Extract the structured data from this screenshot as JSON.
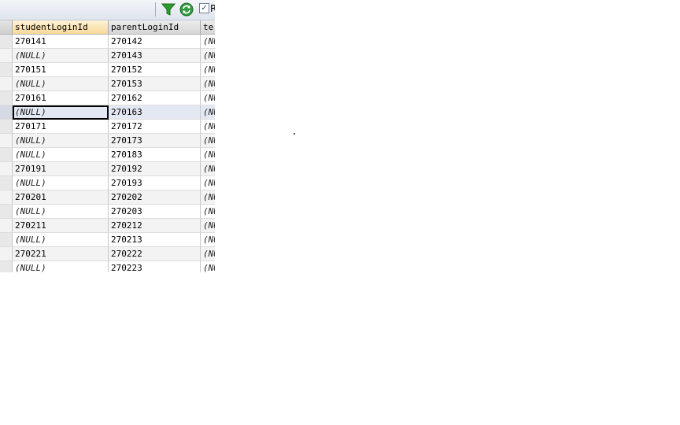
{
  "toolbar": {
    "filter_icon": "filter-funnel-icon",
    "refresh_icon": "refresh-icon",
    "checkbox_mark": "✓",
    "clipped_label": "R"
  },
  "grid": {
    "columns": [
      "studentLoginId",
      "parentLoginId",
      "te"
    ],
    "null_text": "(NULL)",
    "clipped_null": "(NU",
    "rows": [
      {
        "student": "270141",
        "parent": "270142",
        "third": "(NU"
      },
      {
        "student": "(NULL)",
        "parent": "270143",
        "third": "(NU"
      },
      {
        "student": "270151",
        "parent": "270152",
        "third": "(NU"
      },
      {
        "student": "(NULL)",
        "parent": "270153",
        "third": "(NU"
      },
      {
        "student": "270161",
        "parent": "270162",
        "third": "(NU"
      },
      {
        "student": "(NULL)",
        "parent": "270163",
        "third": "(NU",
        "selected": true
      },
      {
        "student": "270171",
        "parent": "270172",
        "third": "(NU"
      },
      {
        "student": "(NULL)",
        "parent": "270173",
        "third": "(NU"
      },
      {
        "student": "(NULL)",
        "parent": "270183",
        "third": "(NU"
      },
      {
        "student": "270191",
        "parent": "270192",
        "third": "(NU"
      },
      {
        "student": "(NULL)",
        "parent": "270193",
        "third": "(NU"
      },
      {
        "student": "270201",
        "parent": "270202",
        "third": "(NU"
      },
      {
        "student": "(NULL)",
        "parent": "270203",
        "third": "(NU"
      },
      {
        "student": "270211",
        "parent": "270212",
        "third": "(NU"
      },
      {
        "student": "(NULL)",
        "parent": "270213",
        "third": "(NU"
      },
      {
        "student": "270221",
        "parent": "270222",
        "third": "(NU"
      },
      {
        "student": "(NULL)",
        "parent": "270223",
        "third": "(NU"
      }
    ]
  }
}
